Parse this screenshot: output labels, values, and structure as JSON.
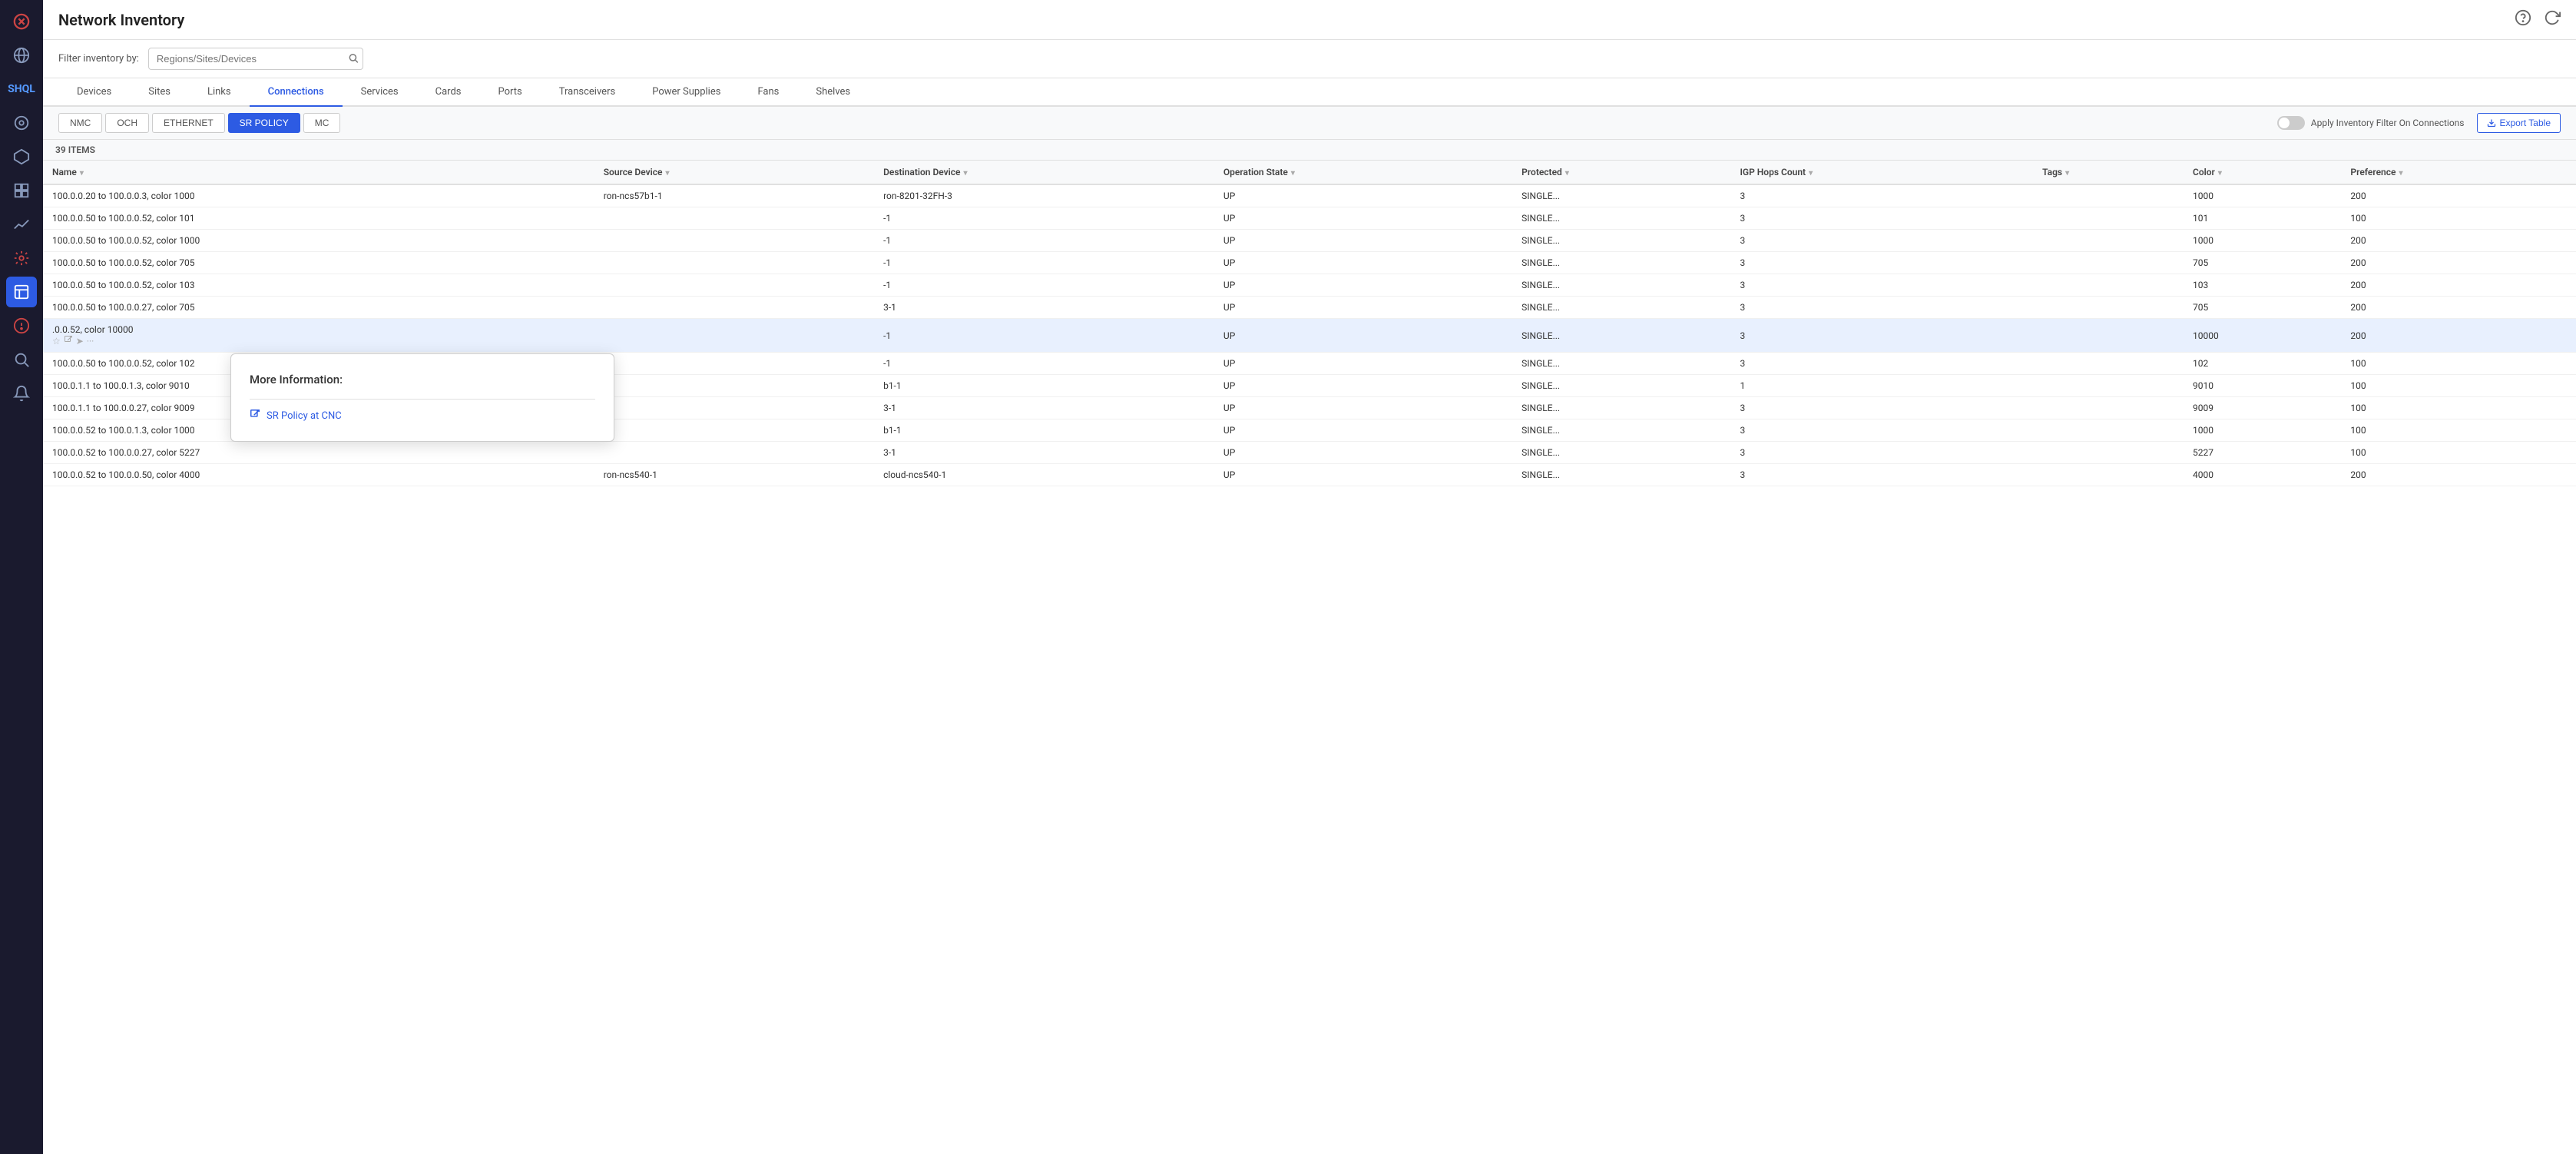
{
  "app": {
    "title": "Network Inventory"
  },
  "sidebar": {
    "icons": [
      {
        "name": "close-icon",
        "symbol": "✕",
        "active": false
      },
      {
        "name": "globe-icon",
        "symbol": "🌐",
        "active": false
      },
      {
        "name": "shql-icon",
        "symbol": "S",
        "active": false
      },
      {
        "name": "topology-icon",
        "symbol": "⊙",
        "active": false
      },
      {
        "name": "network-icon",
        "symbol": "⬡",
        "active": false
      },
      {
        "name": "layers-icon",
        "symbol": "⊞",
        "active": false
      },
      {
        "name": "analytics-icon",
        "symbol": "〜",
        "active": false
      },
      {
        "name": "tools-icon",
        "symbol": "🔧",
        "active": false
      },
      {
        "name": "inventory-icon",
        "symbol": "📋",
        "active": true
      },
      {
        "name": "alarm-icon",
        "symbol": "⚠",
        "active": false
      },
      {
        "name": "search-icon",
        "symbol": "🔍",
        "active": false
      },
      {
        "name": "notification-icon",
        "symbol": "🔔",
        "active": false
      }
    ]
  },
  "filter": {
    "label": "Filter inventory by:",
    "placeholder": "Regions/Sites/Devices"
  },
  "tabs": [
    {
      "label": "Devices",
      "active": false
    },
    {
      "label": "Sites",
      "active": false
    },
    {
      "label": "Links",
      "active": false
    },
    {
      "label": "Connections",
      "active": true
    },
    {
      "label": "Services",
      "active": false
    },
    {
      "label": "Cards",
      "active": false
    },
    {
      "label": "Ports",
      "active": false
    },
    {
      "label": "Transceivers",
      "active": false
    },
    {
      "label": "Power Supplies",
      "active": false
    },
    {
      "label": "Fans",
      "active": false
    },
    {
      "label": "Shelves",
      "active": false
    }
  ],
  "sub_tabs": [
    {
      "label": "NMC",
      "active": false
    },
    {
      "label": "OCH",
      "active": false
    },
    {
      "label": "ETHERNET",
      "active": false
    },
    {
      "label": "SR POLICY",
      "active": true
    },
    {
      "label": "MC",
      "active": false
    }
  ],
  "toggle": {
    "label": "Apply Inventory Filter On Connections",
    "on": false
  },
  "export_button": "Export Table",
  "table": {
    "items_count": "39 ITEMS",
    "columns": [
      {
        "label": "Name",
        "sortable": true
      },
      {
        "label": "Source Device",
        "sortable": true
      },
      {
        "label": "Destination Device",
        "sortable": true
      },
      {
        "label": "Operation State",
        "sortable": true
      },
      {
        "label": "Protected",
        "sortable": true
      },
      {
        "label": "IGP Hops Count",
        "sortable": true
      },
      {
        "label": "Tags",
        "sortable": true
      },
      {
        "label": "Color",
        "sortable": true
      },
      {
        "label": "Preference",
        "sortable": true
      }
    ],
    "rows": [
      {
        "name": "100.0.0.20 to 100.0.0.3, color 1000",
        "source": "ron-ncs57b1-1",
        "destination": "ron-8201-32FH-3",
        "op_state": "UP",
        "protected": "SINGLE...",
        "igp_hops": "3",
        "tags": "",
        "color": "1000",
        "preference": "200",
        "highlighted": false
      },
      {
        "name": "100.0.0.50 to 100.0.0.52, color 101",
        "source": "",
        "destination": "-1",
        "op_state": "UP",
        "protected": "SINGLE...",
        "igp_hops": "3",
        "tags": "",
        "color": "101",
        "preference": "100",
        "highlighted": false
      },
      {
        "name": "100.0.0.50 to 100.0.0.52, color 1000",
        "source": "",
        "destination": "-1",
        "op_state": "UP",
        "protected": "SINGLE...",
        "igp_hops": "3",
        "tags": "",
        "color": "1000",
        "preference": "200",
        "highlighted": false
      },
      {
        "name": "100.0.0.50 to 100.0.0.52, color 705",
        "source": "",
        "destination": "-1",
        "op_state": "UP",
        "protected": "SINGLE...",
        "igp_hops": "3",
        "tags": "",
        "color": "705",
        "preference": "200",
        "highlighted": false
      },
      {
        "name": "100.0.0.50 to 100.0.0.52, color 103",
        "source": "",
        "destination": "-1",
        "op_state": "UP",
        "protected": "SINGLE...",
        "igp_hops": "3",
        "tags": "",
        "color": "103",
        "preference": "200",
        "highlighted": false
      },
      {
        "name": "100.0.0.50 to 100.0.0.27, color 705",
        "source": "",
        "destination": "3-1",
        "op_state": "UP",
        "protected": "SINGLE...",
        "igp_hops": "3",
        "tags": "",
        "color": "705",
        "preference": "200",
        "highlighted": false
      },
      {
        "name": ".0.0.52, color 10000",
        "source": "",
        "destination": "-1",
        "op_state": "UP",
        "protected": "SINGLE...",
        "igp_hops": "3",
        "tags": "",
        "color": "10000",
        "preference": "200",
        "highlighted": true
      },
      {
        "name": "100.0.0.50 to 100.0.0.52, color 102",
        "source": "",
        "destination": "-1",
        "op_state": "UP",
        "protected": "SINGLE...",
        "igp_hops": "3",
        "tags": "",
        "color": "102",
        "preference": "100",
        "highlighted": false
      },
      {
        "name": "100.0.1.1 to 100.0.1.3, color 9010",
        "source": "",
        "destination": "b1-1",
        "op_state": "UP",
        "protected": "SINGLE...",
        "igp_hops": "1",
        "tags": "",
        "color": "9010",
        "preference": "100",
        "highlighted": false
      },
      {
        "name": "100.0.1.1 to 100.0.0.27, color 9009",
        "source": "",
        "destination": "3-1",
        "op_state": "UP",
        "protected": "SINGLE...",
        "igp_hops": "3",
        "tags": "",
        "color": "9009",
        "preference": "100",
        "highlighted": false
      },
      {
        "name": "100.0.0.52 to 100.0.1.3, color 1000",
        "source": "",
        "destination": "b1-1",
        "op_state": "UP",
        "protected": "SINGLE...",
        "igp_hops": "3",
        "tags": "",
        "color": "1000",
        "preference": "100",
        "highlighted": false
      },
      {
        "name": "100.0.0.52 to 100.0.0.27, color 5227",
        "source": "",
        "destination": "3-1",
        "op_state": "UP",
        "protected": "SINGLE...",
        "igp_hops": "3",
        "tags": "",
        "color": "5227",
        "preference": "100",
        "highlighted": false
      },
      {
        "name": "100.0.0.52 to 100.0.0.50, color 4000",
        "source": "ron-ncs540-1",
        "destination": "cloud-ncs540-1",
        "op_state": "UP",
        "protected": "SINGLE...",
        "igp_hops": "3",
        "tags": "",
        "color": "4000",
        "preference": "200",
        "highlighted": false
      }
    ]
  },
  "popup": {
    "title": "More Information:",
    "link_label": "SR Policy at CNC",
    "link_icon": "🔗"
  }
}
